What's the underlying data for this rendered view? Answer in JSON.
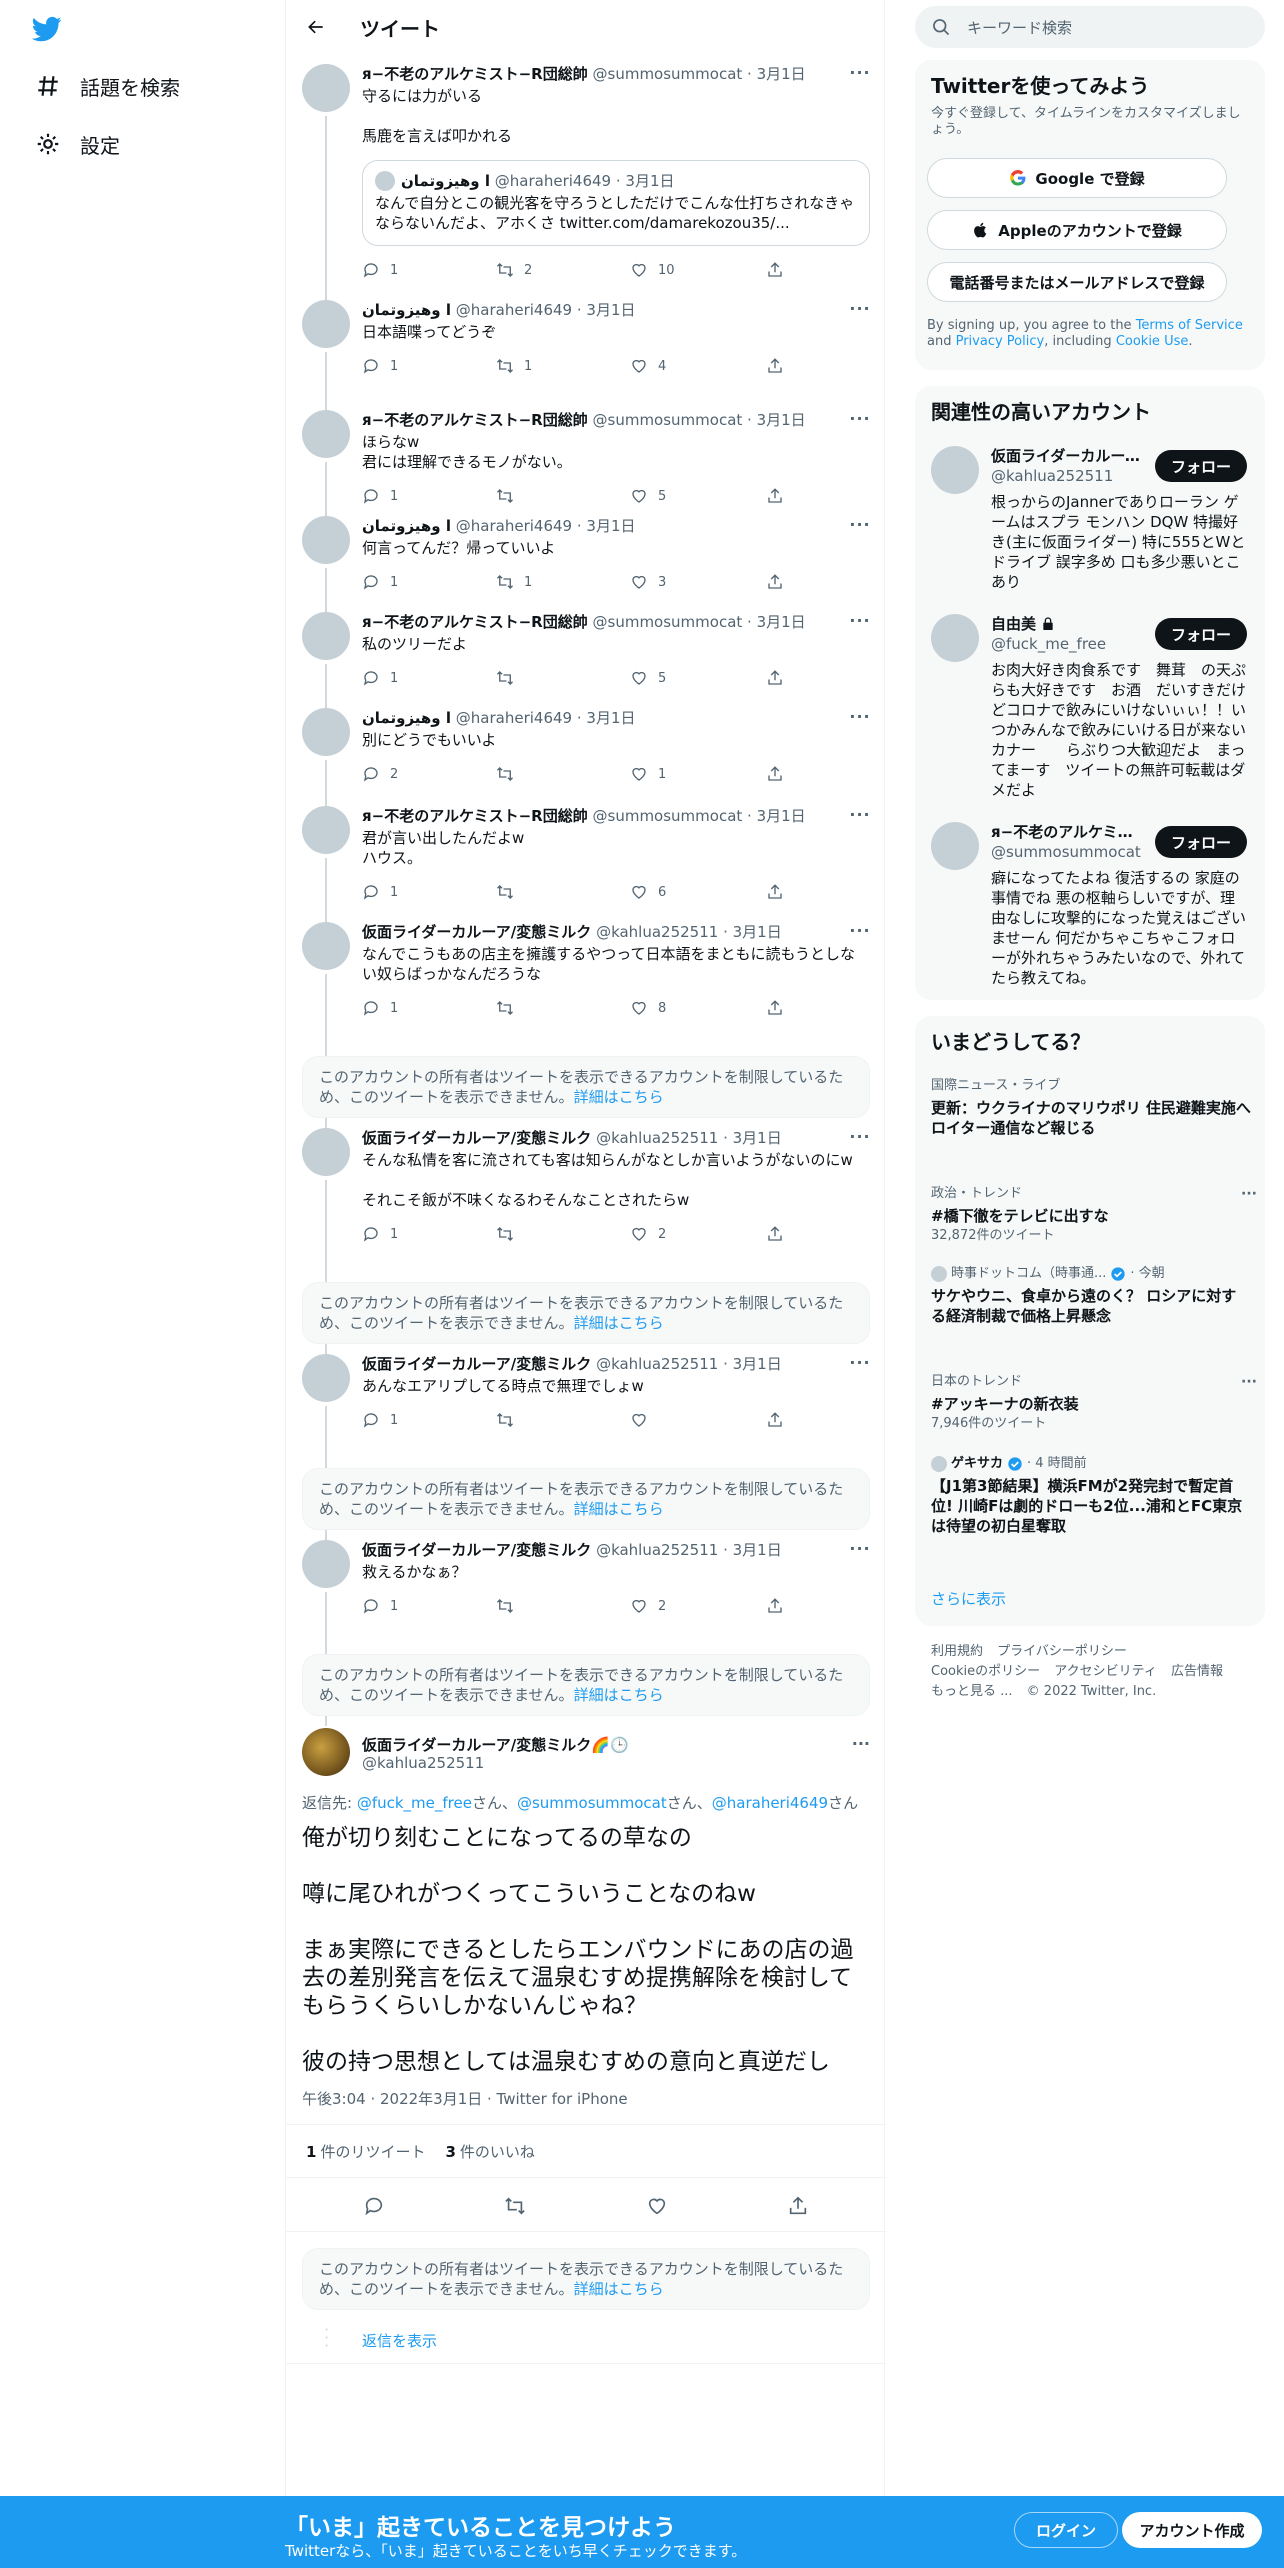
{
  "nav": {
    "explore_label": "話題を検索",
    "settings_label": "設定"
  },
  "header": {
    "title": "ツイート"
  },
  "thread": [
    {
      "name": "я−不老のアルケミスト−R団総帥",
      "meta": "@summosummocat · 3月1日",
      "text": "守るには力がいる\n\n馬鹿を言えば叩かれる",
      "quote": {
        "name": "وهيزوتمان l",
        "meta": "@haraheri4649 · 3月1日",
        "text": "なんで自分とこの観光客を守ろうとしただけでこんな仕打ちされなきゃならないんだよ、アホくさ twitter.com/damarekozou35/..."
      },
      "replies": "1",
      "retweets": "2",
      "likes": "10"
    },
    {
      "name": "وهيزوتمان l",
      "meta": "@haraheri4649 · 3月1日",
      "text": "日本語喋ってどうぞ",
      "replies": "1",
      "retweets": "1",
      "likes": "4"
    },
    {
      "name": "я−不老のアルケミスト−R団総帥",
      "meta": "@summosummocat · 3月1日",
      "text": "ほらなw\n君には理解できるモノがない。",
      "replies": "1",
      "retweets": "",
      "likes": "5"
    },
    {
      "name": "وهيزوتمان l",
      "meta": "@haraheri4649 · 3月1日",
      "text": "何言ってんだ？帰っていいよ",
      "replies": "1",
      "retweets": "1",
      "likes": "3"
    },
    {
      "name": "я−不老のアルケミスト−R団総帥",
      "meta": "@summosummocat · 3月1日",
      "text": "私のツリーだよ",
      "replies": "1",
      "retweets": "",
      "likes": "5"
    },
    {
      "name": "وهيزوتمان l",
      "meta": "@haraheri4649 · 3月1日",
      "text": "別にどうでもいいよ",
      "replies": "2",
      "retweets": "",
      "likes": "1"
    },
    {
      "name": "я−不老のアルケミスト−R団総帥",
      "meta": "@summosummocat · 3月1日",
      "text": "君が言い出したんだよw\nハウス。",
      "replies": "1",
      "retweets": "",
      "likes": "6"
    },
    {
      "name": "仮面ライダーカルーア/変態ミルク",
      "meta": "@kahlua252511 · 3月1日",
      "text": "なんでこうもあの店主を擁護するやつって日本語をまともに読もうとしない奴らばっかなんだろうな",
      "replies": "1",
      "retweets": "",
      "likes": "8"
    },
    {
      "name": "仮面ライダーカルーア/変態ミルク",
      "meta": "@kahlua252511 · 3月1日",
      "text": "そんな私情を客に流されても客は知らんがなとしか言いようがないのにw\n\nそれこそ飯が不味くなるわそんなことされたらw",
      "replies": "1",
      "retweets": "",
      "likes": "2"
    },
    {
      "name": "仮面ライダーカルーア/変態ミルク",
      "meta": "@kahlua252511 · 3月1日",
      "text": "あんなエアリプしてる時点で無理でしょw",
      "replies": "1",
      "retweets": "",
      "likes": ""
    },
    {
      "name": "仮面ライダーカルーア/変態ミルク",
      "meta": "@kahlua252511 · 3月1日",
      "text": "救えるかなぁ？",
      "replies": "1",
      "retweets": "",
      "likes": "2"
    }
  ],
  "restricted": {
    "text": "このアカウントの所有者はツイートを表示できるアカウントを制限しているため、このツイートを表示できません。",
    "link": "詳細はこちら"
  },
  "main_tweet": {
    "name": "仮面ライダーカルーア/変態ミルク🌈🕒",
    "handle": "@kahlua252511",
    "reply_prefix": "返信先: ",
    "reply_to_1": "@fuck_me_free",
    "reply_to_2": "@summosummocat",
    "reply_to_3": "@haraheri4649",
    "san": "さん、",
    "san_end": "さん",
    "text": "俺が切り刻むことになってるの草なの\n\n噂に尾ひれがつくってこういうことなのねw\n\nまぁ実際にできるとしたらエンバウンドにあの店の過去の差別発言を伝えて温泉むすめ提携解除を検討してもらうくらいしかないんじゃね？\n\n彼の持つ思想としては温泉むすめの意向と真逆だし",
    "time": "午後3:04 · 2022年3月1日 · Twitter for iPhone",
    "retweet_count": "1",
    "retweet_label": "件のリツイート",
    "like_count": "3",
    "like_label": "件のいいね"
  },
  "show_replies": "返信を表示",
  "search": {
    "placeholder": "キーワード検索"
  },
  "signup": {
    "title": "Twitterを使ってみよう",
    "subtitle": "今すぐ登録して、タイムラインをカスタマイズしましょう。",
    "google": "Google で登録",
    "apple": "Appleのアカウントで登録",
    "phone": "電話番号またはメールアドレスで登録",
    "legal_1": "By signing up, you agree to the ",
    "legal_terms": "Terms of Service",
    "legal_and": " and ",
    "legal_privacy": "Privacy Policy",
    "legal_incl": ", including ",
    "legal_cookie": "Cookie Use",
    "legal_end": "."
  },
  "related": {
    "title": "関連性の高いアカウント",
    "follow": "フォロー",
    "accounts": [
      {
        "name": "仮面ライダーカルーア/変態ミルク",
        "handle": "@kahlua252511",
        "bio": "根っからのJannerでありローラン ゲームはスプラ モンハン DQW 特撮好き(主に仮面ライダー) 特に555とWとドライブ 誤字多め 口も多少悪いとこあり"
      },
      {
        "name": "自由美",
        "handle": "@fuck_me_free",
        "bio": "お肉大好き肉食系です　舞茸　の天ぷらも大好きです　お酒　だいすきだけどコロナで飲みにいけないぃぃ！！いつかみんなで飲みにいける日が来ないカナー　　らぶりつ大歓迎だよ　まってまーす　ツイートの無許可転載はダメだよ"
      },
      {
        "name": "я−不老のアルケミスト−R団総帥",
        "handle": "@summosummocat",
        "bio": "癖になってたよね 復活するの 家庭の事情でね 悪の枢軸らしいですが、理由なしに攻撃的になった覚えはございませーん 何だかちゃこちゃこフォローが外れちゃうみたいなので、外れてたら教えてね。"
      }
    ]
  },
  "trends": {
    "title": "いまどうしてる？",
    "items": [
      {
        "cat": "国際ニュース・ライブ",
        "title": "更新：ウクライナのマリウポリ 住民避難実施へ ロイター通信など報じる",
        "count": ""
      },
      {
        "cat": "政治・トレンド",
        "title": "#橋下徹をテレビに出すな",
        "count": "32,872件のツイート"
      },
      {
        "cat": "時事ドットコム（時事通...",
        "cat_suffix": "· 今朝",
        "title": "サケやウニ、食卓から遠のく？ ロシアに対する経済制裁で価格上昇懸念",
        "count": ""
      },
      {
        "cat": "日本のトレンド",
        "title": "#アッキーナの新衣装",
        "count": "7,946件のツイート"
      },
      {
        "cat": "ゲキサカ",
        "cat_suffix": "· 4 時間前",
        "title": "【J1第3節結果】横浜FMが2発完封で暫定首位! 川崎Fは劇的ドローも2位...浦和とFC東京は待望の初白星奪取",
        "count": ""
      }
    ],
    "show_more": "さらに表示"
  },
  "footer": {
    "terms": "利用規約",
    "privacy": "プライバシーポリシー",
    "cookie": "Cookieのポリシー",
    "accessibility": "アクセシビリティ",
    "ads": "広告情報",
    "more": "もっと見る ...",
    "copyright": "© 2022 Twitter, Inc."
  },
  "bottom_bar": {
    "title": "「いま」起きていることを見つけよう",
    "subtitle": "Twitterなら、「いま」起きていることをいち早くチェックできます。",
    "login": "ログイン",
    "signup": "アカウント作成"
  },
  "colors": {
    "accent": "#1d9bf0",
    "text": "#0f1419",
    "muted": "#536471",
    "border": "#eff3f4"
  }
}
